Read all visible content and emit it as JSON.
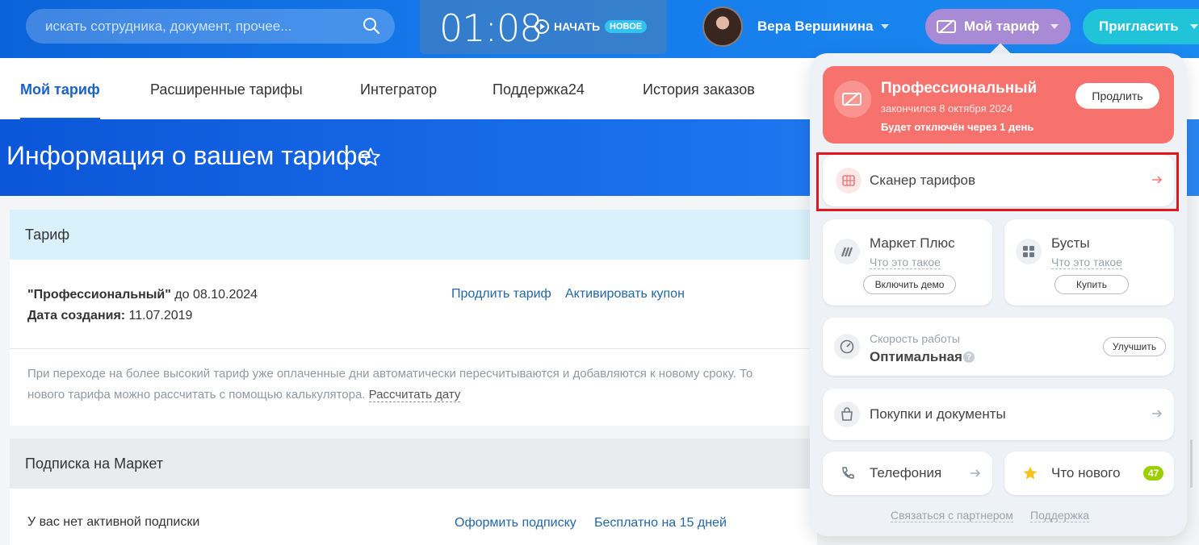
{
  "header": {
    "search_placeholder": "искать сотрудника, документ, прочее...",
    "timer": {
      "time": "01:08",
      "start_label": "НАЧАТЬ",
      "badge": "НОВОЕ"
    },
    "user_name": "Вера Вершинина",
    "tariff_button": "Мой тариф",
    "invite_button": "Пригласить"
  },
  "tabs": [
    {
      "label": "Мой тариф"
    },
    {
      "label": "Расширенные тарифы"
    },
    {
      "label": "Интегратор"
    },
    {
      "label": "Поддержка24"
    },
    {
      "label": "История заказов"
    }
  ],
  "page": {
    "title": "Информация о вашем тарифе"
  },
  "tariff_panel": {
    "heading": "Тариф",
    "plan_name": "\"Профессиональный\"",
    "plan_until": " до 08.10.2024",
    "created_label": "Дата создания:",
    "created_value": " 11.07.2019",
    "extend_link": "Продлить тариф",
    "coupon_link": "Активировать купон",
    "note_line1": "При переходе на более высокий тариф уже оплаченные дни автоматически пересчитываются и добавляются к новому сроку. То",
    "note_line2": "нового тарифа можно рассчитать с помощью калькулятора. ",
    "calc_link": "Рассчитать дату"
  },
  "market_panel": {
    "heading": "Подписка на Маркет",
    "status": "У вас нет активной подписки",
    "subscribe_link": "Оформить подписку",
    "trial_link": "Бесплатно на 15 дней"
  },
  "dropdown": {
    "pro": {
      "title": "Профессиональный",
      "ended": "закончился 8 октября 2024",
      "disable": "Будет отключён через 1 день",
      "extend_button": "Продлить"
    },
    "scanner": {
      "label": "Сканер тарифов"
    },
    "market_plus": {
      "title": "Маркет Плюс",
      "what": "Что это такое",
      "button": "Включить демо"
    },
    "boosts": {
      "title": "Бусты",
      "what": "Что это такое",
      "button": "Купить"
    },
    "speed": {
      "label": "Скорость работы",
      "value": "Оптимальная",
      "button": "Улучшить"
    },
    "purchases": {
      "label": "Покупки и документы"
    },
    "telephony": {
      "label": "Телефония"
    },
    "whats_new": {
      "label": "Что нового",
      "count": "47"
    },
    "footer": {
      "partner": "Связаться с партнером",
      "support": "Поддержка"
    }
  },
  "colors": {
    "header": "#1579ea",
    "pro_card": "#f7716d",
    "accent_link": "#2367a8",
    "highlight": "#e5161a"
  }
}
